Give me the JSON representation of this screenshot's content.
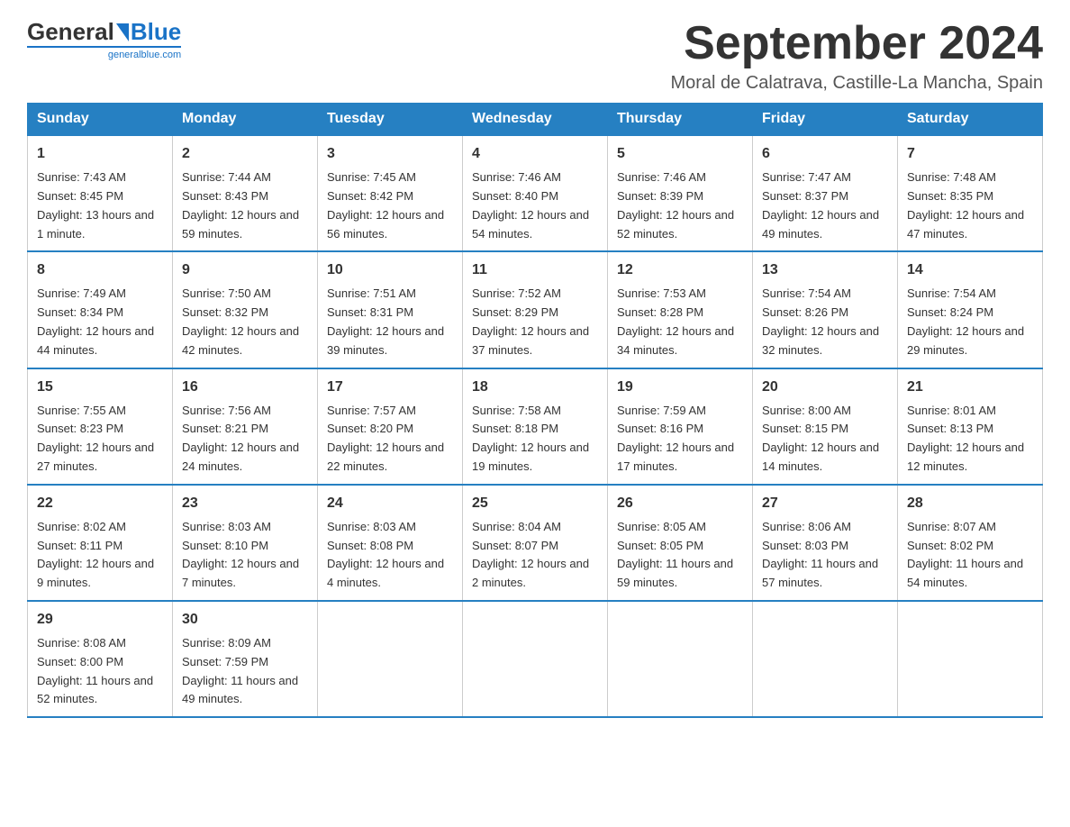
{
  "header": {
    "logo_general": "General",
    "logo_blue": "Blue",
    "calendar_title": "September 2024",
    "calendar_subtitle": "Moral de Calatrava, Castille-La Mancha, Spain"
  },
  "weekdays": [
    "Sunday",
    "Monday",
    "Tuesday",
    "Wednesday",
    "Thursday",
    "Friday",
    "Saturday"
  ],
  "weeks": [
    [
      {
        "day": "1",
        "sunrise": "7:43 AM",
        "sunset": "8:45 PM",
        "daylight": "13 hours and 1 minute."
      },
      {
        "day": "2",
        "sunrise": "7:44 AM",
        "sunset": "8:43 PM",
        "daylight": "12 hours and 59 minutes."
      },
      {
        "day": "3",
        "sunrise": "7:45 AM",
        "sunset": "8:42 PM",
        "daylight": "12 hours and 56 minutes."
      },
      {
        "day": "4",
        "sunrise": "7:46 AM",
        "sunset": "8:40 PM",
        "daylight": "12 hours and 54 minutes."
      },
      {
        "day": "5",
        "sunrise": "7:46 AM",
        "sunset": "8:39 PM",
        "daylight": "12 hours and 52 minutes."
      },
      {
        "day": "6",
        "sunrise": "7:47 AM",
        "sunset": "8:37 PM",
        "daylight": "12 hours and 49 minutes."
      },
      {
        "day": "7",
        "sunrise": "7:48 AM",
        "sunset": "8:35 PM",
        "daylight": "12 hours and 47 minutes."
      }
    ],
    [
      {
        "day": "8",
        "sunrise": "7:49 AM",
        "sunset": "8:34 PM",
        "daylight": "12 hours and 44 minutes."
      },
      {
        "day": "9",
        "sunrise": "7:50 AM",
        "sunset": "8:32 PM",
        "daylight": "12 hours and 42 minutes."
      },
      {
        "day": "10",
        "sunrise": "7:51 AM",
        "sunset": "8:31 PM",
        "daylight": "12 hours and 39 minutes."
      },
      {
        "day": "11",
        "sunrise": "7:52 AM",
        "sunset": "8:29 PM",
        "daylight": "12 hours and 37 minutes."
      },
      {
        "day": "12",
        "sunrise": "7:53 AM",
        "sunset": "8:28 PM",
        "daylight": "12 hours and 34 minutes."
      },
      {
        "day": "13",
        "sunrise": "7:54 AM",
        "sunset": "8:26 PM",
        "daylight": "12 hours and 32 minutes."
      },
      {
        "day": "14",
        "sunrise": "7:54 AM",
        "sunset": "8:24 PM",
        "daylight": "12 hours and 29 minutes."
      }
    ],
    [
      {
        "day": "15",
        "sunrise": "7:55 AM",
        "sunset": "8:23 PM",
        "daylight": "12 hours and 27 minutes."
      },
      {
        "day": "16",
        "sunrise": "7:56 AM",
        "sunset": "8:21 PM",
        "daylight": "12 hours and 24 minutes."
      },
      {
        "day": "17",
        "sunrise": "7:57 AM",
        "sunset": "8:20 PM",
        "daylight": "12 hours and 22 minutes."
      },
      {
        "day": "18",
        "sunrise": "7:58 AM",
        "sunset": "8:18 PM",
        "daylight": "12 hours and 19 minutes."
      },
      {
        "day": "19",
        "sunrise": "7:59 AM",
        "sunset": "8:16 PM",
        "daylight": "12 hours and 17 minutes."
      },
      {
        "day": "20",
        "sunrise": "8:00 AM",
        "sunset": "8:15 PM",
        "daylight": "12 hours and 14 minutes."
      },
      {
        "day": "21",
        "sunrise": "8:01 AM",
        "sunset": "8:13 PM",
        "daylight": "12 hours and 12 minutes."
      }
    ],
    [
      {
        "day": "22",
        "sunrise": "8:02 AM",
        "sunset": "8:11 PM",
        "daylight": "12 hours and 9 minutes."
      },
      {
        "day": "23",
        "sunrise": "8:03 AM",
        "sunset": "8:10 PM",
        "daylight": "12 hours and 7 minutes."
      },
      {
        "day": "24",
        "sunrise": "8:03 AM",
        "sunset": "8:08 PM",
        "daylight": "12 hours and 4 minutes."
      },
      {
        "day": "25",
        "sunrise": "8:04 AM",
        "sunset": "8:07 PM",
        "daylight": "12 hours and 2 minutes."
      },
      {
        "day": "26",
        "sunrise": "8:05 AM",
        "sunset": "8:05 PM",
        "daylight": "11 hours and 59 minutes."
      },
      {
        "day": "27",
        "sunrise": "8:06 AM",
        "sunset": "8:03 PM",
        "daylight": "11 hours and 57 minutes."
      },
      {
        "day": "28",
        "sunrise": "8:07 AM",
        "sunset": "8:02 PM",
        "daylight": "11 hours and 54 minutes."
      }
    ],
    [
      {
        "day": "29",
        "sunrise": "8:08 AM",
        "sunset": "8:00 PM",
        "daylight": "11 hours and 52 minutes."
      },
      {
        "day": "30",
        "sunrise": "8:09 AM",
        "sunset": "7:59 PM",
        "daylight": "11 hours and 49 minutes."
      },
      null,
      null,
      null,
      null,
      null
    ]
  ]
}
